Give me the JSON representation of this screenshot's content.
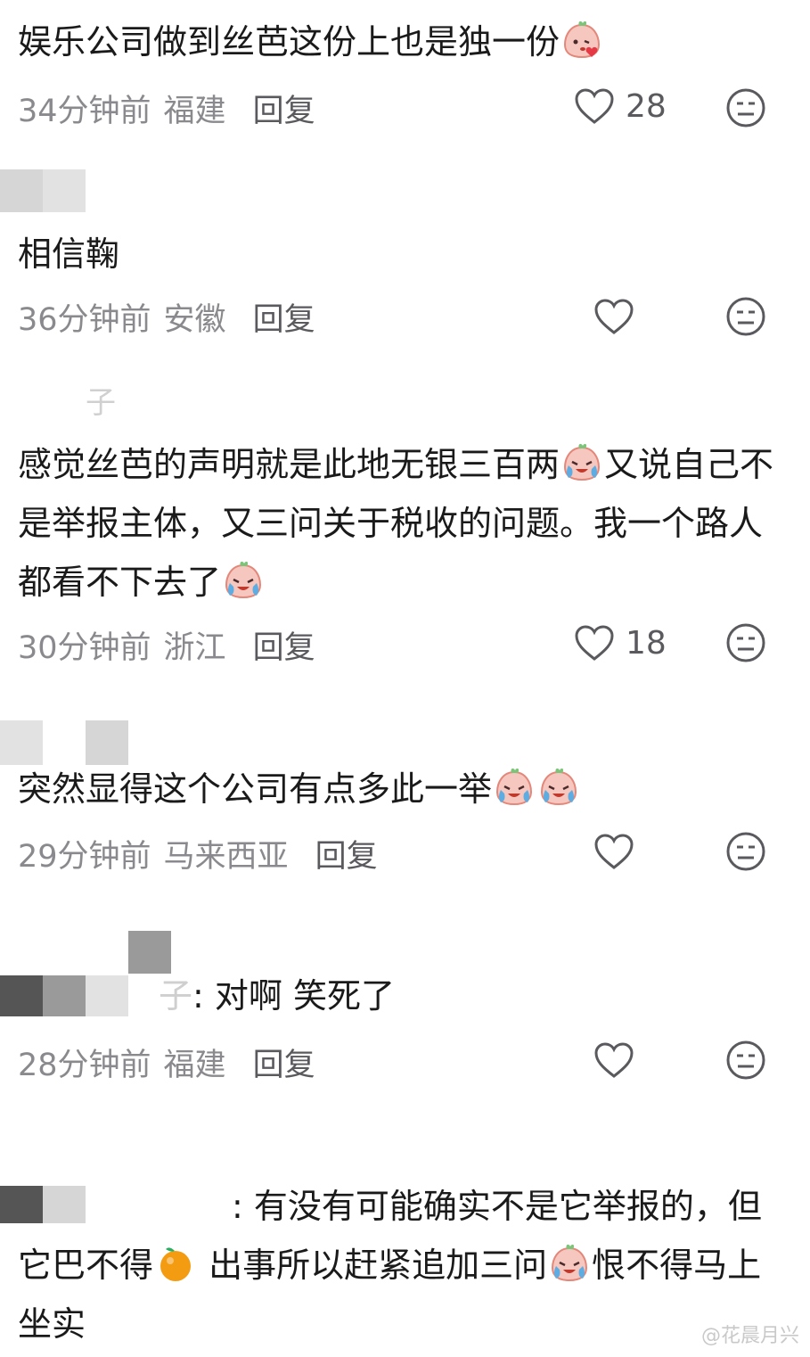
{
  "comments": [
    {
      "username": "",
      "text_parts": [
        "娱乐公司做到丝芭这份上也是独一份",
        ""
      ],
      "time": "34分钟前",
      "region": "福建",
      "reply_label": "回复",
      "likes": "28",
      "emojis": [
        "kiss-face"
      ]
    },
    {
      "username": "",
      "text_parts": [
        "相信鞠"
      ],
      "time": "36分钟前",
      "region": "安徽",
      "reply_label": "回复",
      "likes": ""
    },
    {
      "username": "子",
      "text_parts": [
        "感觉丝芭的声明就是此地无银三百两",
        "又说自己不是举报主体，又三问关于税收的问题。我一个路人都看不下去了",
        ""
      ],
      "time": "30分钟前",
      "region": "浙江",
      "reply_label": "回复",
      "likes": "18",
      "emojis": [
        "crying-face",
        "crying-face"
      ]
    },
    {
      "username": "",
      "text_parts": [
        "突然显得这个公司有点多此一举",
        ""
      ],
      "time": "29分钟前",
      "region": "马来西亚",
      "reply_label": "回复",
      "likes": "",
      "emojis": [
        "crying-face",
        "crying-face"
      ]
    },
    {
      "username": "子",
      "reply_prefix": ": ",
      "text_parts": [
        "对啊 笑死了"
      ],
      "time": "28分钟前",
      "region": "福建",
      "reply_label": "回复",
      "likes": ""
    },
    {
      "username": "",
      "reply_prefix": ": ",
      "text_parts": [
        "有没有可能确实不是它举报的，但它巴不得",
        " 出事所以赶紧追加三问",
        "恨不得马上坐实"
      ],
      "emojis": [
        "orange",
        "crying-face"
      ]
    }
  ],
  "watermark": "@花晨月兴",
  "colors": {
    "text": "#1a1a1a",
    "meta": "#8a8a8e",
    "icon": "#5a5a5e"
  }
}
